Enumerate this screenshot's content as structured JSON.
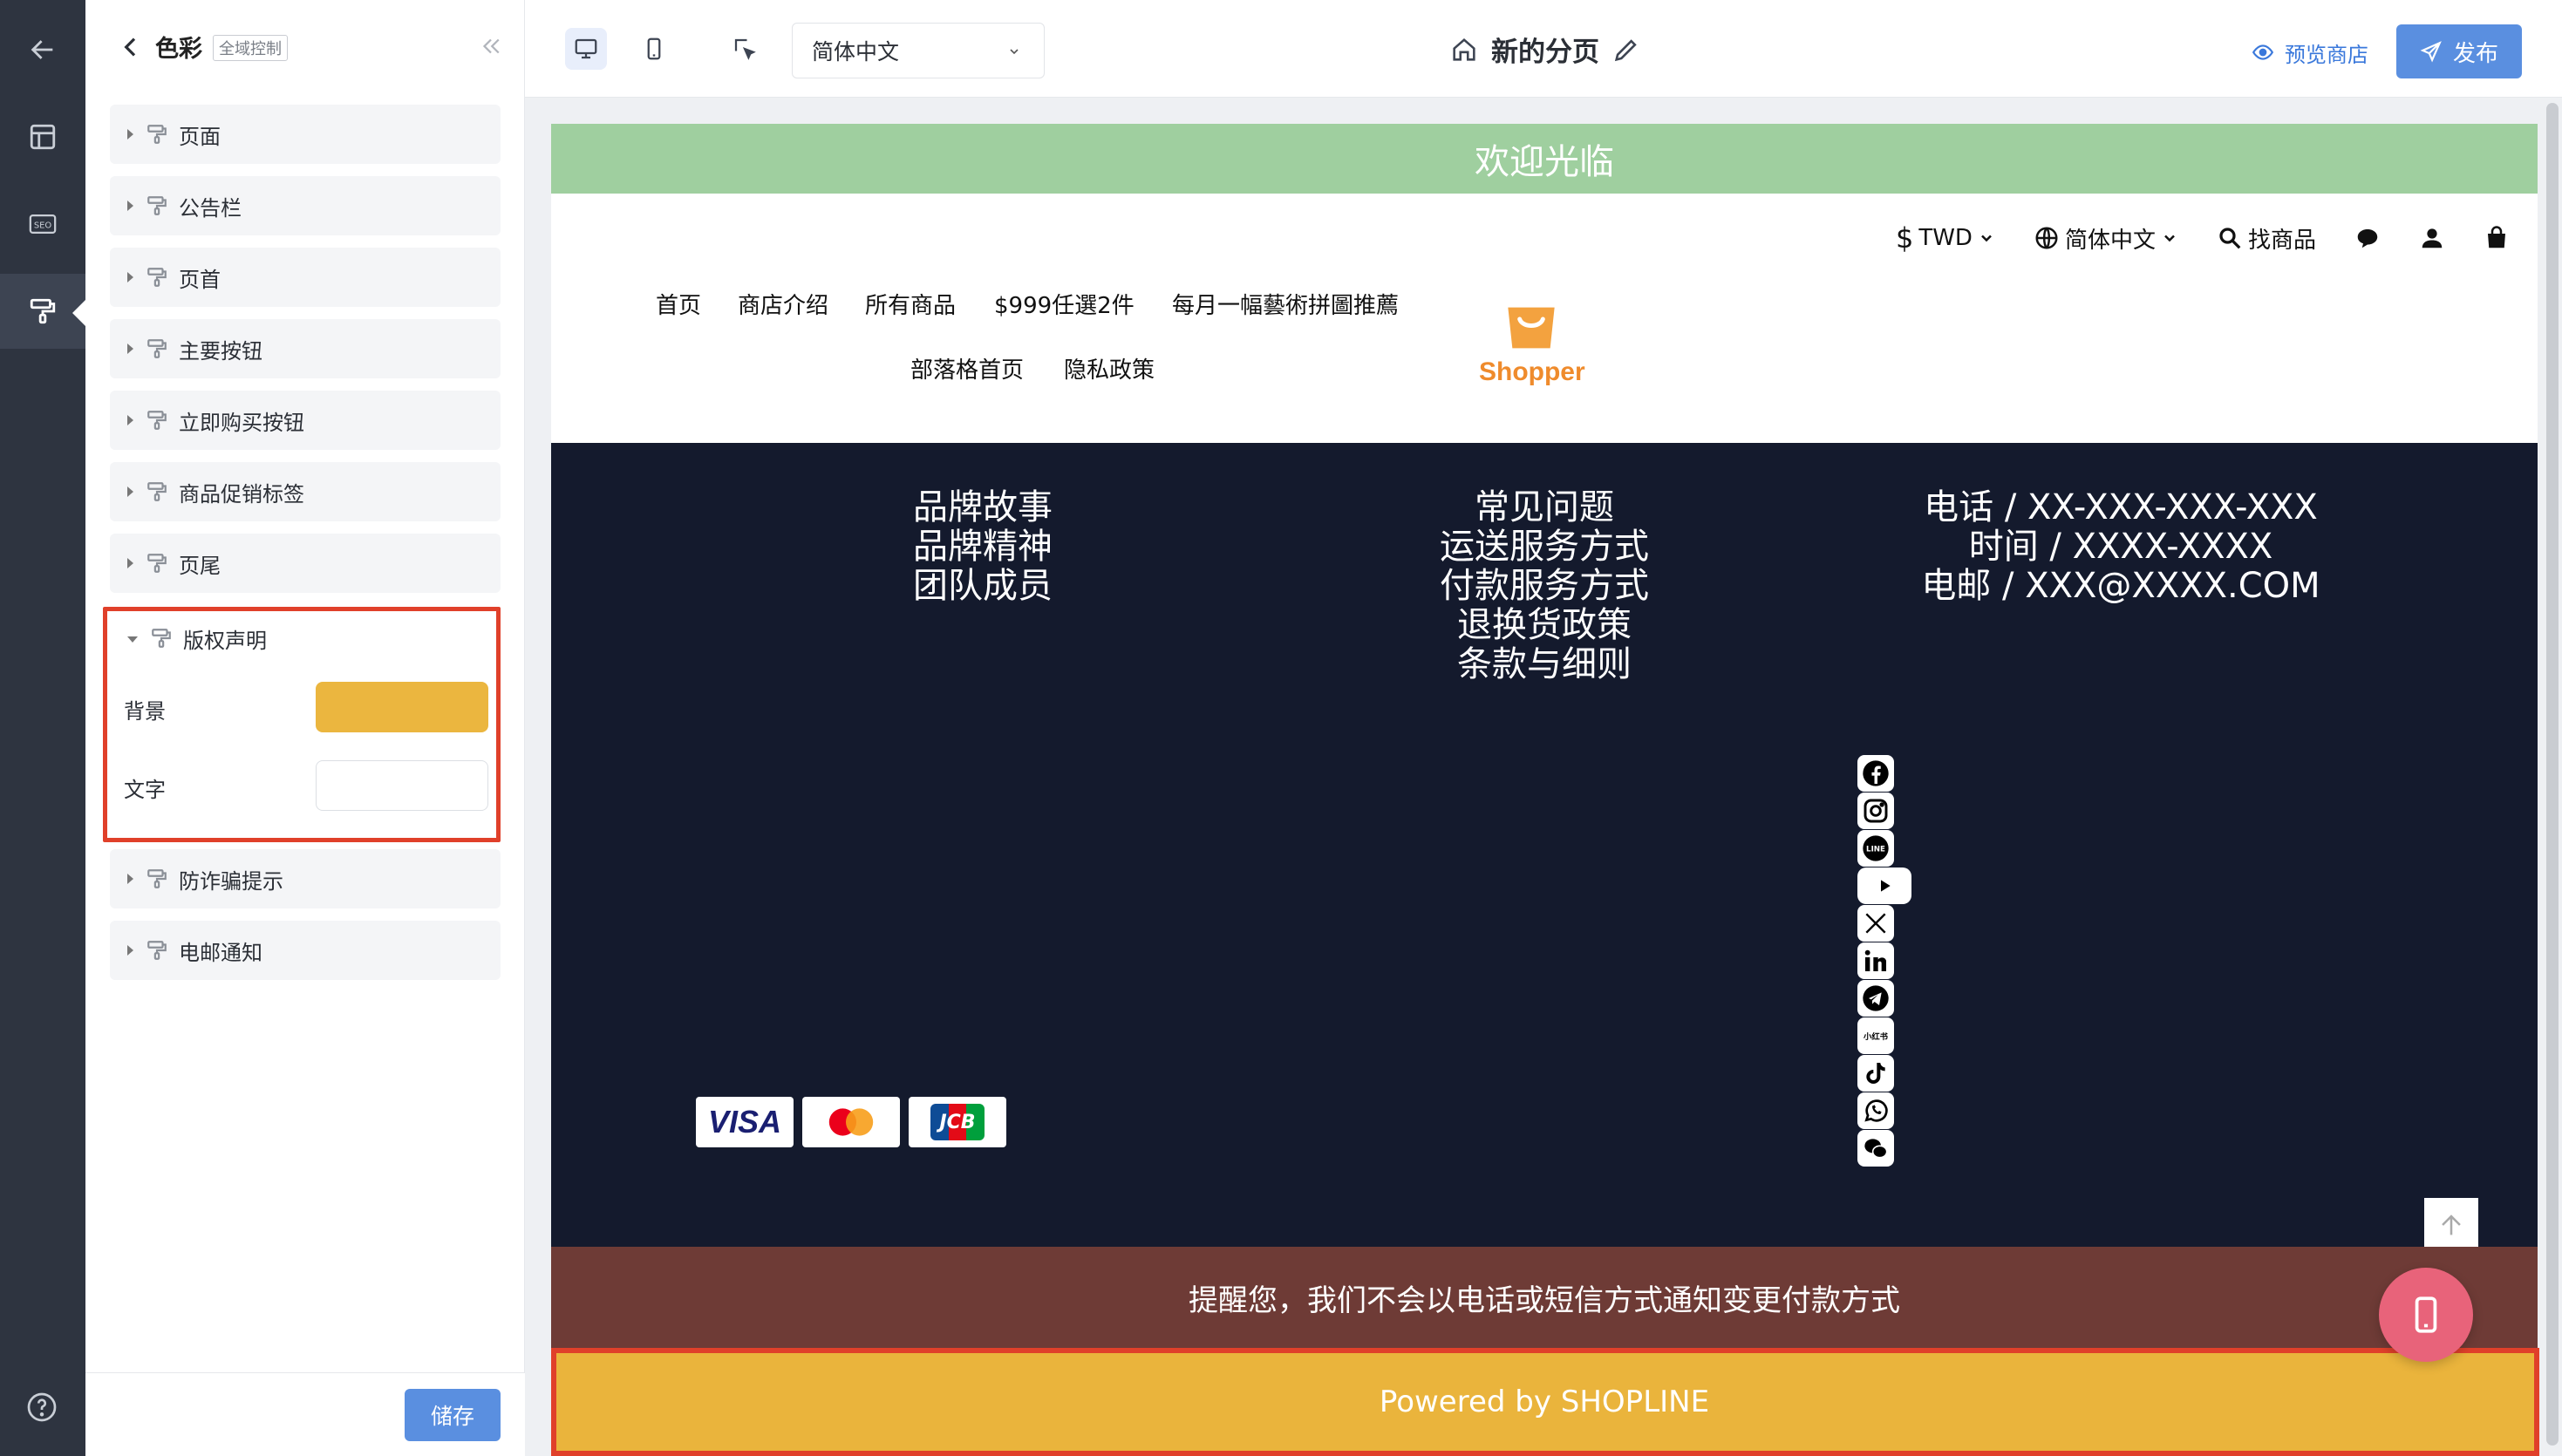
{
  "panel": {
    "title": "色彩",
    "tag": "全域控制",
    "sections": [
      {
        "label": "页面"
      },
      {
        "label": "公告栏"
      },
      {
        "label": "页首"
      },
      {
        "label": "主要按钮"
      },
      {
        "label": "立即购买按钮"
      },
      {
        "label": "商品促销标签"
      },
      {
        "label": "页尾"
      },
      {
        "label": "版权声明",
        "expanded": true
      },
      {
        "label": "防诈骗提示"
      },
      {
        "label": "电邮通知"
      }
    ],
    "copyright_fields": {
      "background_label": "背景",
      "background_color": "#EBB63F",
      "text_label": "文字",
      "text_color": "#FFFFFF"
    },
    "save_label": "储存"
  },
  "topbar": {
    "language": "简体中文",
    "page_name": "新的分页",
    "preview_label": "预览商店",
    "publish_label": "发布"
  },
  "site": {
    "announcement": "欢迎光临",
    "utility": {
      "currency": "TWD",
      "currency_symbol": "$",
      "language": "简体中文",
      "search": "找商品"
    },
    "nav": {
      "row1": [
        "首页",
        "商店介绍",
        "所有商品",
        "$999任選2件",
        "每月一幅藝術拼圖推薦"
      ],
      "row2": [
        "部落格首页",
        "隐私政策"
      ]
    },
    "logo_text": "Shopper",
    "footer": {
      "col1": [
        "品牌故事",
        "品牌精神",
        "团队成员"
      ],
      "col2": [
        "常见问题",
        "运送服务方式",
        "付款服务方式",
        "退换货政策",
        "条款与细则"
      ],
      "col3": [
        "电话 / XX-XXX-XXX-XXX",
        "时间 / XXXX-XXXX",
        "电邮 / XXX@XXXX.COM"
      ],
      "social": [
        "facebook-icon",
        "instagram-icon",
        "line-icon",
        "youtube-icon",
        "x-icon",
        "linkedin-icon",
        "telegram-icon",
        "xiaohongshu-icon",
        "tiktok-icon",
        "whatsapp-icon",
        "wechat-icon"
      ],
      "social_line_text": "LINE",
      "social_xhs_text": "小红书",
      "payments": [
        "VISA",
        "JCB"
      ]
    },
    "anti_fraud": "提醒您，我们不会以电话或短信方式通知变更付款方式",
    "copyright": "Powered by SHOPLINE"
  },
  "colors": {
    "accent": "#5A8FE0",
    "highlight": "#E0402A",
    "announcement_bg": "#9FCF9F",
    "footer_bg": "#141A2D",
    "anti_fraud_bg": "#6E3B36",
    "copyright_bg": "#EAB43C"
  }
}
